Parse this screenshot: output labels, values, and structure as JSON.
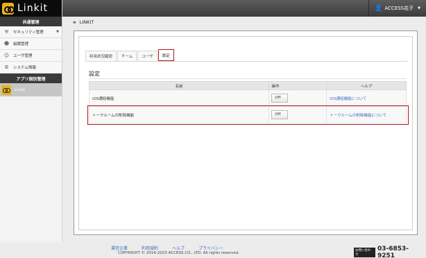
{
  "app": {
    "logo_text": "Linkit"
  },
  "sidebar": {
    "common_header": "共通管理",
    "items": [
      {
        "label": "セキュリティ管理",
        "icon": "shield-icon"
      },
      {
        "label": "組織管理",
        "icon": "group-icon"
      },
      {
        "label": "ユーザ管理",
        "icon": "user-icon"
      },
      {
        "label": "システム情報",
        "icon": "wrench-icon"
      }
    ],
    "app_header": "アプリ個別管理",
    "app_item": "Linkit"
  },
  "topbar": {
    "user_name": "ACCESS花子"
  },
  "breadcrumb": {
    "label": "LINKIT"
  },
  "tabs": [
    {
      "label": "利用状況確認"
    },
    {
      "label": "チーム"
    },
    {
      "label": "ユーザ"
    },
    {
      "label": "設定"
    }
  ],
  "settings": {
    "title": "設定",
    "columns": {
      "name": "名前",
      "operation": "操作",
      "help": "ヘルプ"
    },
    "rows": [
      {
        "name": "iOS通話機能",
        "toggle": "Off",
        "help": "iOS通話機能について"
      },
      {
        "name": "トークルームの削除機能",
        "toggle": "Off",
        "help": "トークルームの削除機能について"
      }
    ]
  },
  "footer": {
    "links": [
      "運営企業",
      "利用規約",
      "ヘルプ",
      "プライバシー"
    ],
    "copyright": "COPYRIGHT © 2014-2023 ACCESS CO., LTD. All rights reserved.",
    "contact_label": "お問い合わせ",
    "contact_number": "03-6853-9251"
  },
  "colors": {
    "accent_red": "#b4141e",
    "link_blue": "#3c6fbf",
    "logo_yellow": "#e9b21a"
  }
}
